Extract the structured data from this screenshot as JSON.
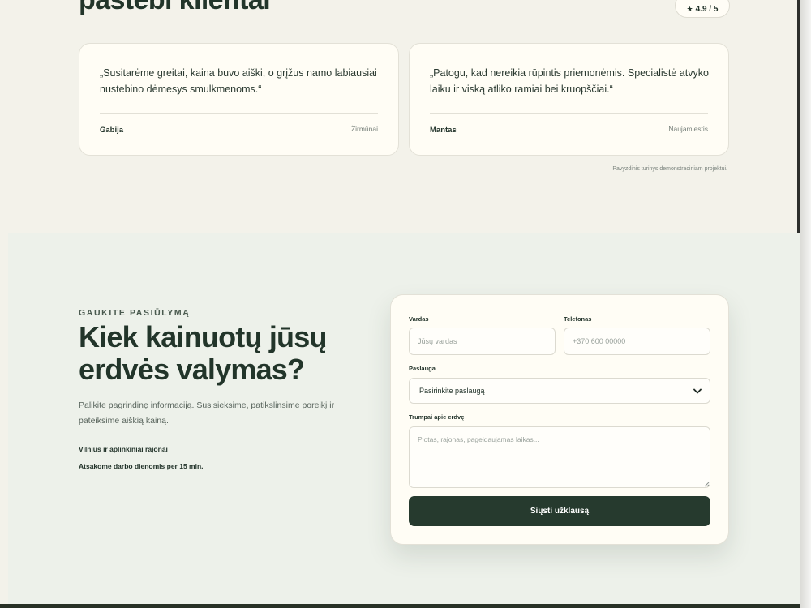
{
  "reviews_section": {
    "title": "pastebi klientai",
    "rating": "4.9 / 5",
    "rating_icon": "star-icon",
    "reviews": [
      {
        "quote": "„Susitarėme greitai, kaina buvo aiški, o grįžus namo labiausiai nustebino dėmesys smulkmenoms.“",
        "name": "Gabija",
        "area": "Žirmūnai"
      },
      {
        "quote": "„Patogu, kad nereikia rūpintis priemonėmis. Specialistė atvyko laiku ir viską atliko ramiai bei kruopščiai.“",
        "name": "Mantas",
        "area": "Naujamiestis"
      }
    ],
    "disclaimer": "Pavyzdinis turinys demonstraciniam projektui."
  },
  "offer": {
    "eyebrow": "GAUKITE PASIŪLYMĄ",
    "title": "Kiek kainuotų jūsų erdvės valymas?",
    "description": "Palikite pagrindinę informaciją. Susisieksime, patikslinsime poreikį ir pateiksime aiškią kainą.",
    "facts": [
      "Vilnius ir aplinkiniai rajonai",
      "Atsakome darbo dienomis per 15 min."
    ]
  },
  "form": {
    "name_label": "Vardas",
    "name_placeholder": "Jūsų vardas",
    "phone_label": "Telefonas",
    "phone_placeholder": "+370 600 00000",
    "service_label": "Paslauga",
    "service_selected": "Pasirinkite paslaugą",
    "details_label": "Trumpai apie erdvę",
    "details_placeholder": "Plotas, rajonas, pageidaujamas laikas...",
    "submit_label": "Siųsti užklausą"
  },
  "colors": {
    "page_bg": "#f3f2ea",
    "section_bg": "#edf1ea",
    "card_bg": "#fffdf5",
    "accent_dark": "#263a2e",
    "heading": "#22352a"
  }
}
